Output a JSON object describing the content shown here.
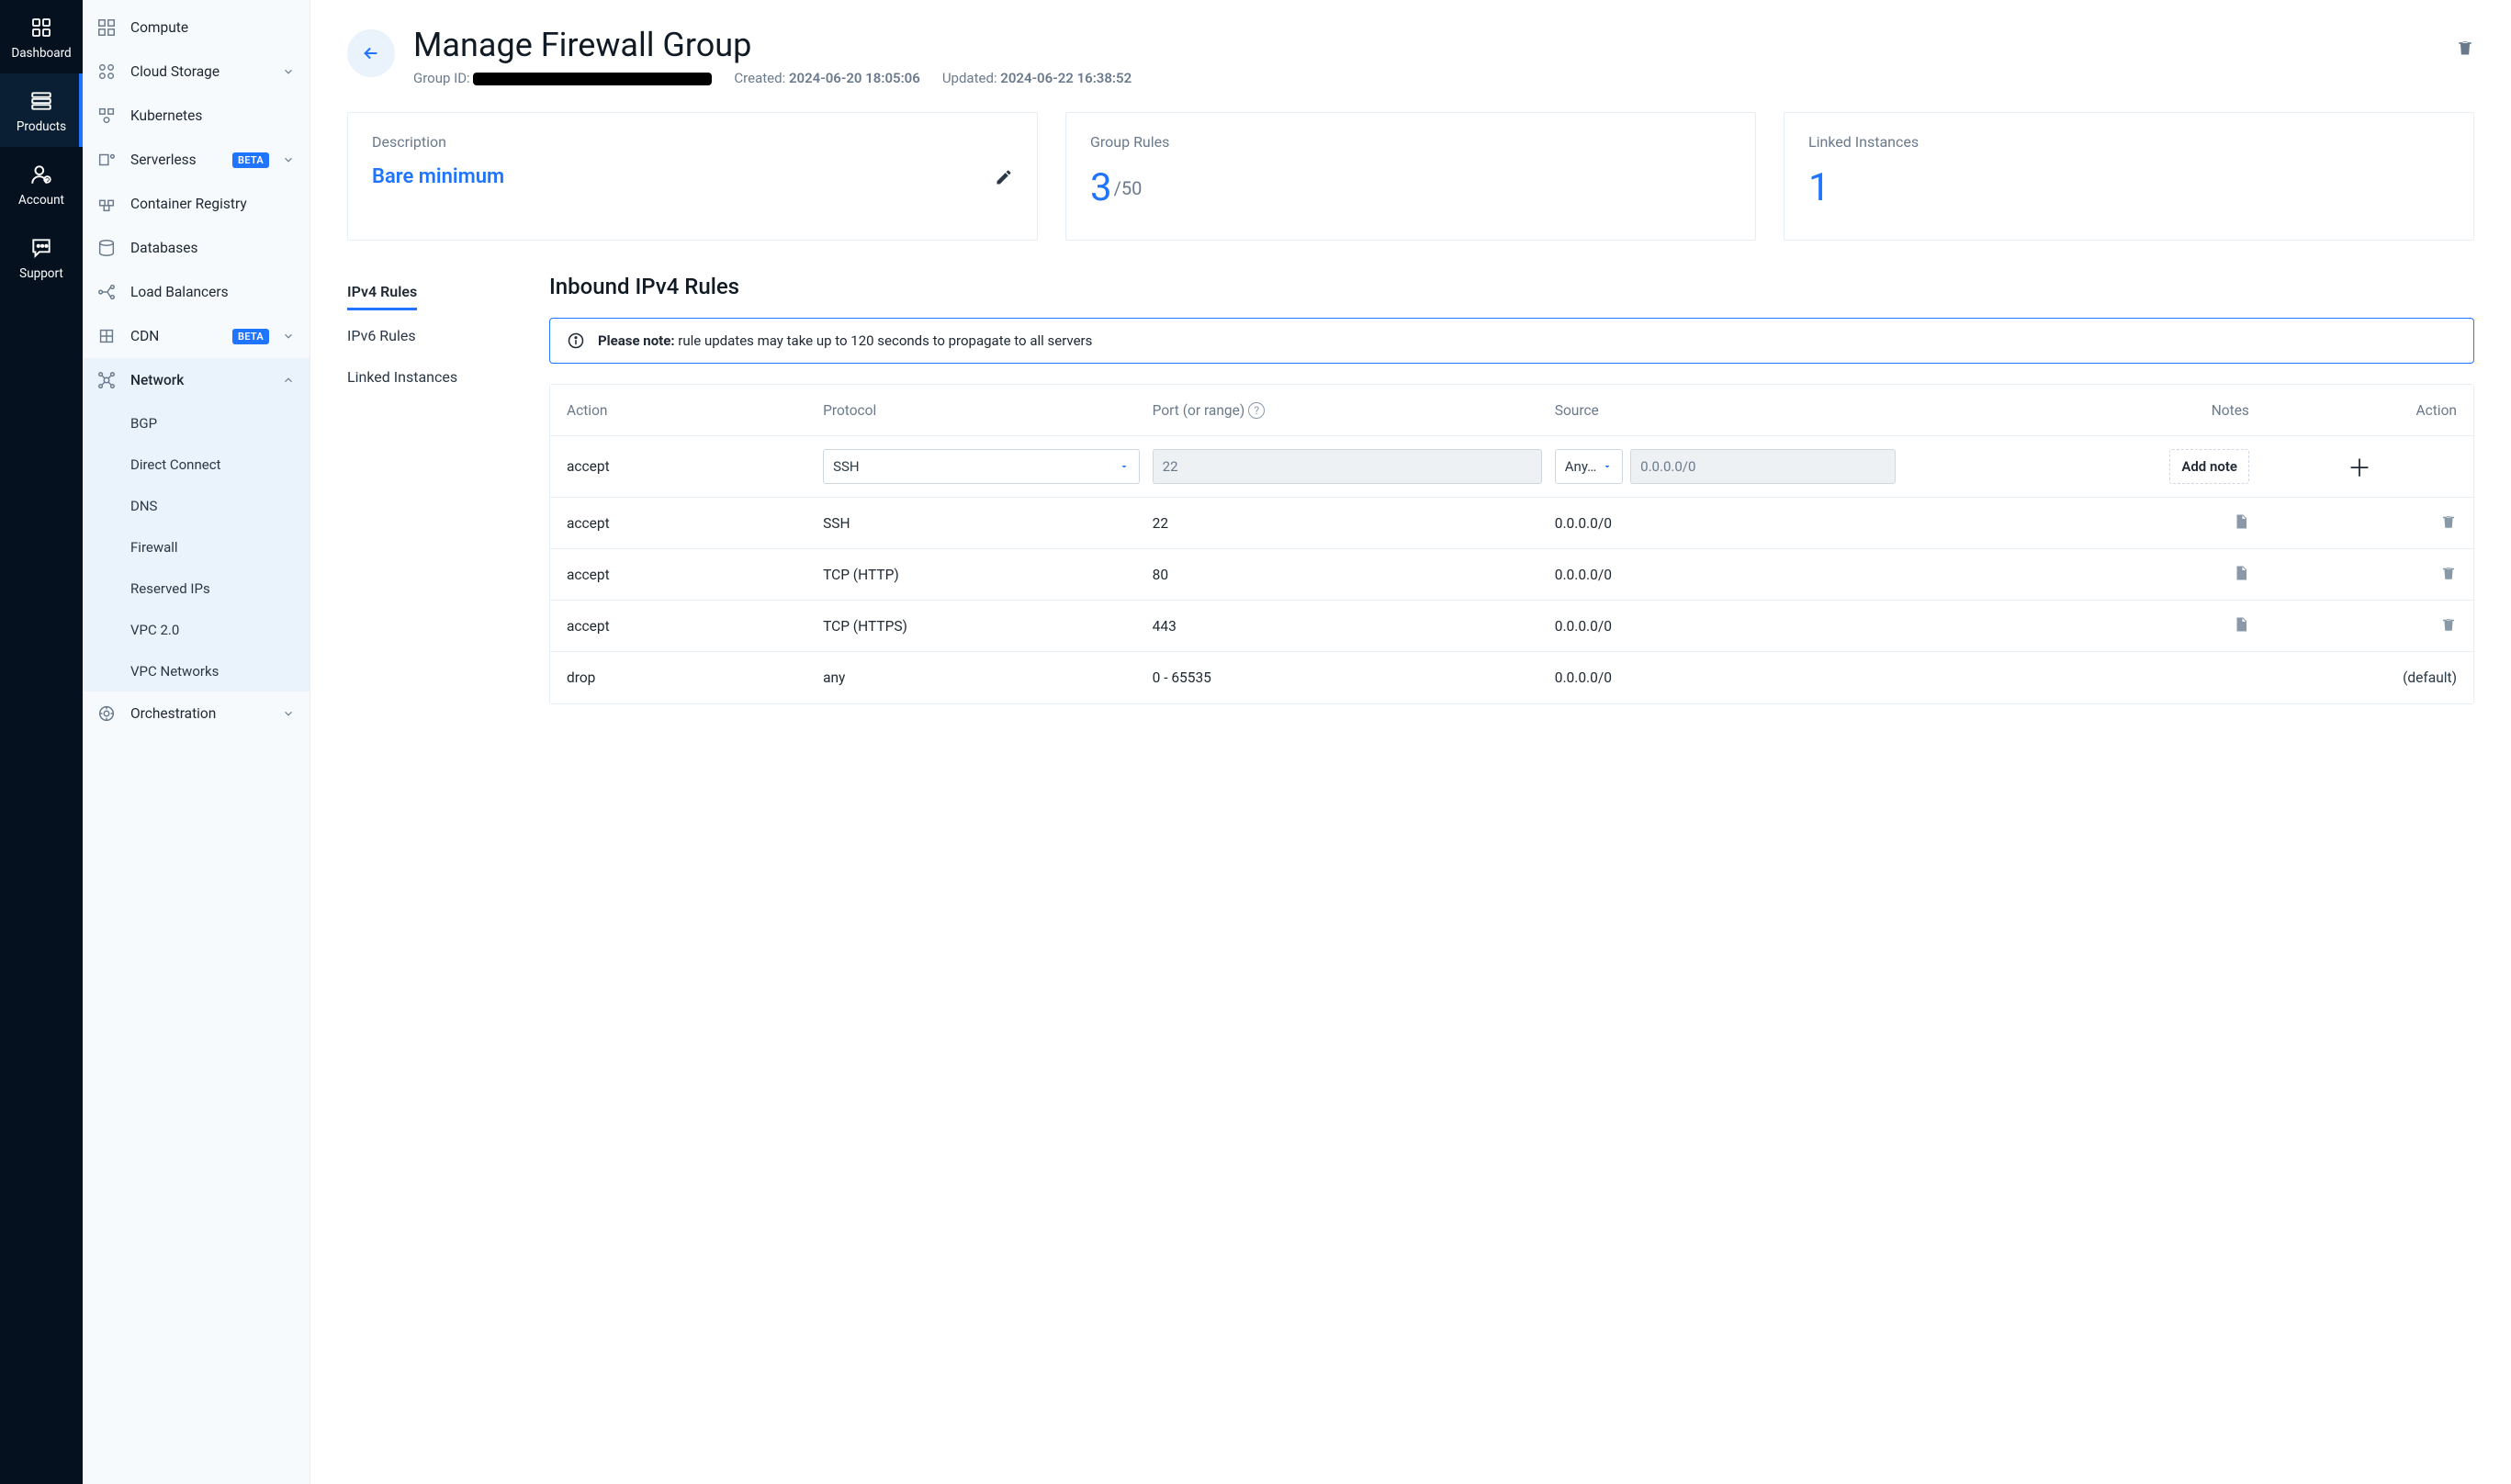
{
  "rail": {
    "items": [
      {
        "label": "Dashboard"
      },
      {
        "label": "Products"
      },
      {
        "label": "Account"
      },
      {
        "label": "Support"
      }
    ]
  },
  "sidebar": {
    "items": [
      {
        "label": "Compute"
      },
      {
        "label": "Cloud Storage"
      },
      {
        "label": "Kubernetes"
      },
      {
        "label": "Serverless",
        "badge": "BETA"
      },
      {
        "label": "Container Registry"
      },
      {
        "label": "Databases"
      },
      {
        "label": "Load Balancers"
      },
      {
        "label": "CDN",
        "badge": "BETA"
      },
      {
        "label": "Network"
      },
      {
        "label": "Orchestration"
      }
    ],
    "network_sub": [
      {
        "label": "BGP"
      },
      {
        "label": "Direct Connect"
      },
      {
        "label": "DNS"
      },
      {
        "label": "Firewall"
      },
      {
        "label": "Reserved IPs"
      },
      {
        "label": "VPC 2.0"
      },
      {
        "label": "VPC Networks"
      }
    ]
  },
  "header": {
    "title": "Manage Firewall Group",
    "group_id_label": "Group ID:",
    "created_label": "Created:",
    "created_val": "2024-06-20 18:05:06",
    "updated_label": "Updated:",
    "updated_val": "2024-06-22 16:38:52"
  },
  "cards": {
    "description": {
      "title": "Description",
      "value": "Bare minimum"
    },
    "group_rules": {
      "title": "Group Rules",
      "value": "3",
      "denom": "/50"
    },
    "linked": {
      "title": "Linked Instances",
      "value": "1"
    }
  },
  "subtabs": [
    {
      "label": "IPv4 Rules"
    },
    {
      "label": "IPv6 Rules"
    },
    {
      "label": "Linked Instances"
    }
  ],
  "rules": {
    "heading": "Inbound IPv4 Rules",
    "notice_bold": "Please note:",
    "notice_text": " rule updates may take up to 120 seconds to propagate to all servers",
    "columns": {
      "action": "Action",
      "protocol": "Protocol",
      "port": "Port (or range)",
      "source": "Source",
      "notes": "Notes",
      "action2": "Action"
    },
    "new_row": {
      "action": "accept",
      "protocol": "SSH",
      "port": "22",
      "source_type": "Any…",
      "source_value": "0.0.0.0/0",
      "add_note": "Add note"
    },
    "rows": [
      {
        "action": "accept",
        "protocol": "SSH",
        "port": "22",
        "source": "0.0.0.0/0"
      },
      {
        "action": "accept",
        "protocol": "TCP (HTTP)",
        "port": "80",
        "source": "0.0.0.0/0"
      },
      {
        "action": "accept",
        "protocol": "TCP (HTTPS)",
        "port": "443",
        "source": "0.0.0.0/0"
      }
    ],
    "default_row": {
      "action": "drop",
      "protocol": "any",
      "port": "0 - 65535",
      "source": "0.0.0.0/0",
      "tag": "(default)"
    }
  }
}
